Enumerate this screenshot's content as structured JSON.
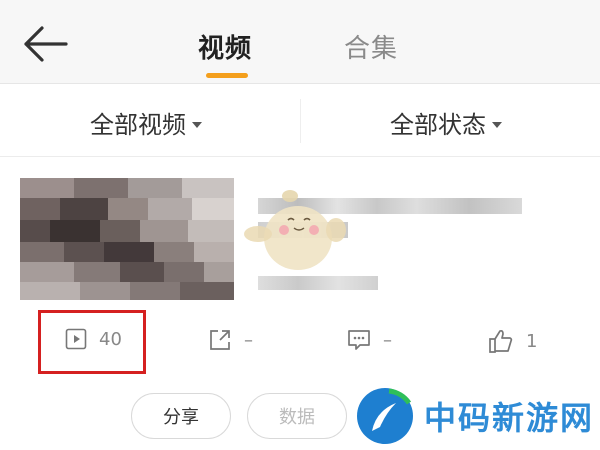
{
  "header": {
    "back_icon": "arrow-left-icon",
    "tabs": [
      {
        "label": "视频",
        "active": true
      },
      {
        "label": "合集",
        "active": false
      }
    ],
    "accent_color": "#f49f1c"
  },
  "filters": {
    "video_filter": "全部视频",
    "status_filter": "全部状态"
  },
  "video": {
    "stats": {
      "plays": "40",
      "shares": "–",
      "comments": "–",
      "likes": "1"
    },
    "actions": {
      "share_label": "分享",
      "data_label": "数据"
    }
  },
  "watermark": {
    "text": "中码新游网",
    "color": "#2e8bd6"
  }
}
